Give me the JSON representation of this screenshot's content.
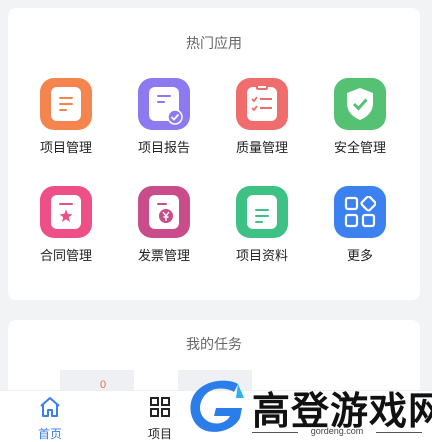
{
  "hot_apps": {
    "title": "热门应用",
    "items": [
      {
        "label": "项目管理",
        "color": "#f5854f",
        "icon": "document-icon"
      },
      {
        "label": "项目报告",
        "color": "#8d79f0",
        "icon": "report-check-icon"
      },
      {
        "label": "质量管理",
        "color": "#f06d6d",
        "icon": "checklist-icon"
      },
      {
        "label": "安全管理",
        "color": "#55c173",
        "icon": "shield-check-icon"
      },
      {
        "label": "合同管理",
        "color": "#ee4f86",
        "icon": "contract-star-icon"
      },
      {
        "label": "发票管理",
        "color": "#c84d8a",
        "icon": "invoice-yen-icon"
      },
      {
        "label": "项目资料",
        "color": "#3ec184",
        "icon": "file-icon"
      },
      {
        "label": "更多",
        "color": "#3b82f0",
        "icon": "grid-apps-icon"
      }
    ]
  },
  "tasks": {
    "title": "我的任务",
    "first_count": "0"
  },
  "tabbar": {
    "home_label": "首页",
    "project_label": "项目",
    "active_color": "#3b7ef0"
  },
  "watermark": {
    "text": "高登游戏网",
    "url": "gordeng.com"
  }
}
